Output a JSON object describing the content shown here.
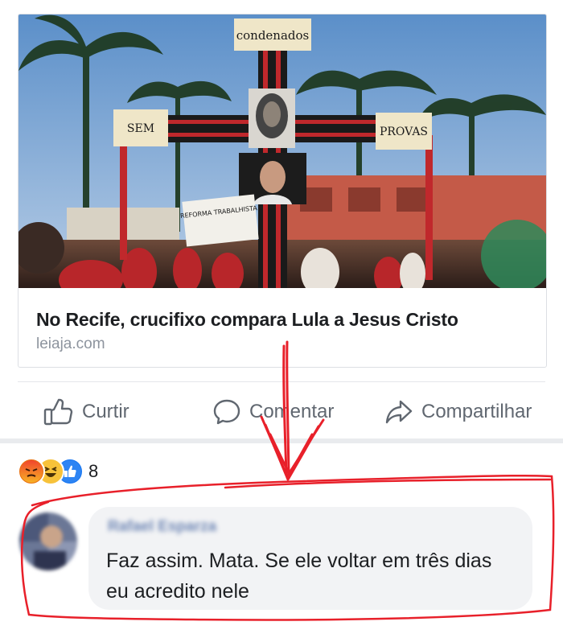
{
  "link_card": {
    "photo_signs": {
      "top": "condenados",
      "left": "SEM",
      "right": "PROVAS",
      "banner": "REFORMA TRABALHISTA"
    },
    "title": "No Recife, crucifixo compara Lula a Jesus Cristo",
    "domain": "leiaja.com"
  },
  "actions": {
    "like_label": "Curtir",
    "comment_label": "Comentar",
    "share_label": "Compartilhar"
  },
  "reactions": {
    "icons": [
      "angry-icon",
      "haha-icon",
      "like-icon"
    ],
    "count": "8"
  },
  "comment": {
    "author": "Rafael Esparza",
    "text": "Faz assim. Mata. Se ele voltar em três dias eu acredito nele"
  },
  "colors": {
    "annotation_red": "#e8202a",
    "link_blue": "#365899",
    "icon_gray": "#606770"
  }
}
